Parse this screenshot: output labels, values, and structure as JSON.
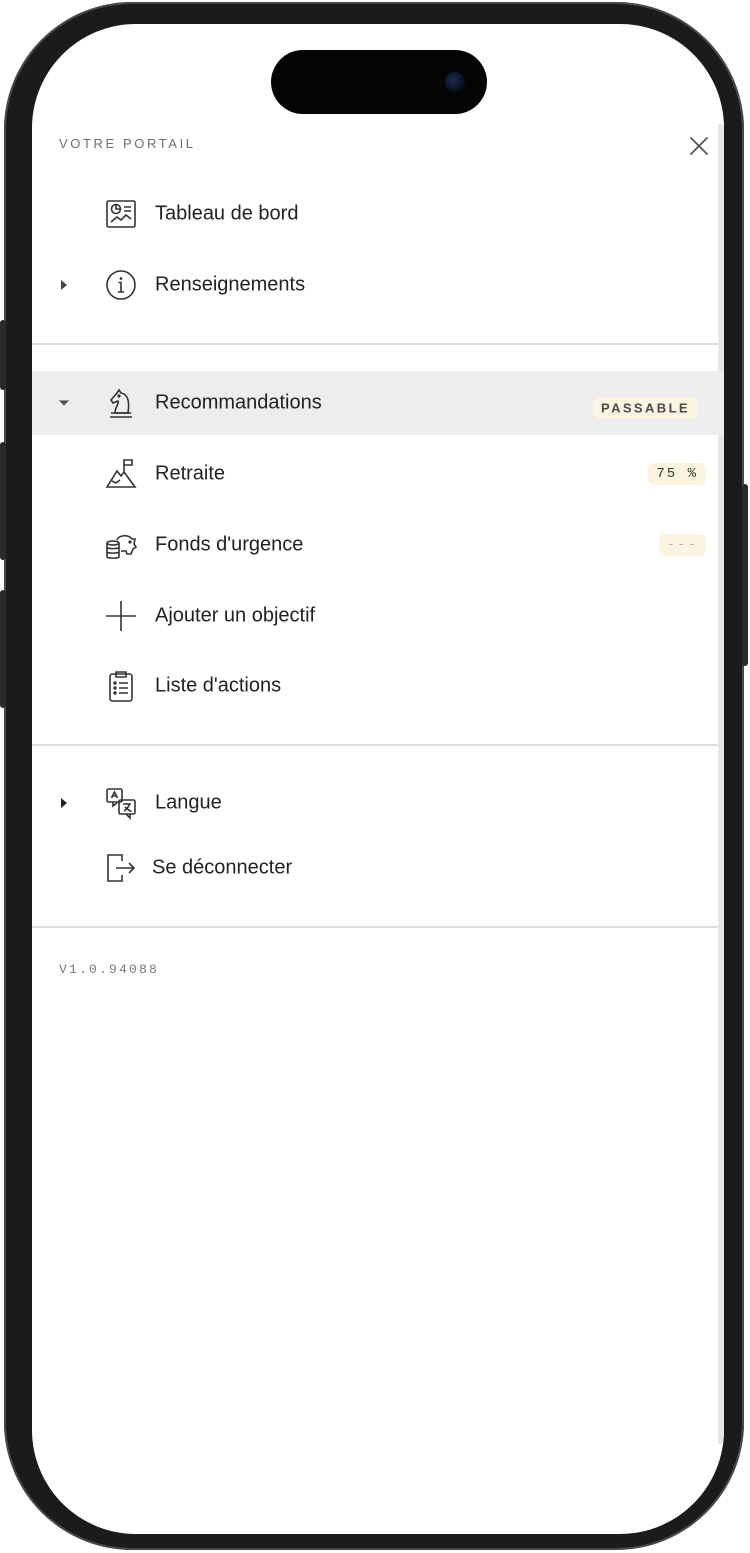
{
  "header": {
    "title": "VOTRE PORTAIL",
    "close_icon": "close-icon"
  },
  "nav": {
    "dashboard": {
      "label": "Tableau de bord",
      "icon": "dashboard-icon"
    },
    "info": {
      "label": "Renseignements",
      "icon": "info-icon",
      "expanded": false
    },
    "recommendations": {
      "label": "Recommandations",
      "icon": "chess-knight-icon",
      "expanded": true,
      "badge": "PASSABLE"
    },
    "retirement": {
      "label": "Retraite",
      "icon": "mountain-flag-icon",
      "badge": "75 %"
    },
    "emergency_fund": {
      "label": "Fonds d'urgence",
      "icon": "piggy-bank-icon",
      "badge": "---"
    },
    "add_goal": {
      "label": "Ajouter un objectif",
      "icon": "plus-icon"
    },
    "action_list": {
      "label": "Liste d'actions",
      "icon": "clipboard-list-icon"
    },
    "language": {
      "label": "Langue",
      "icon": "translate-icon",
      "expanded": false
    },
    "logout": {
      "label": "Se déconnecter",
      "icon": "logout-icon"
    }
  },
  "footer": {
    "version": "V1.0.94088"
  },
  "colors": {
    "active_row": "#ededed",
    "badge_bg": "#fdf3e1",
    "divider": "#dcdcdc",
    "text": "#222222"
  }
}
